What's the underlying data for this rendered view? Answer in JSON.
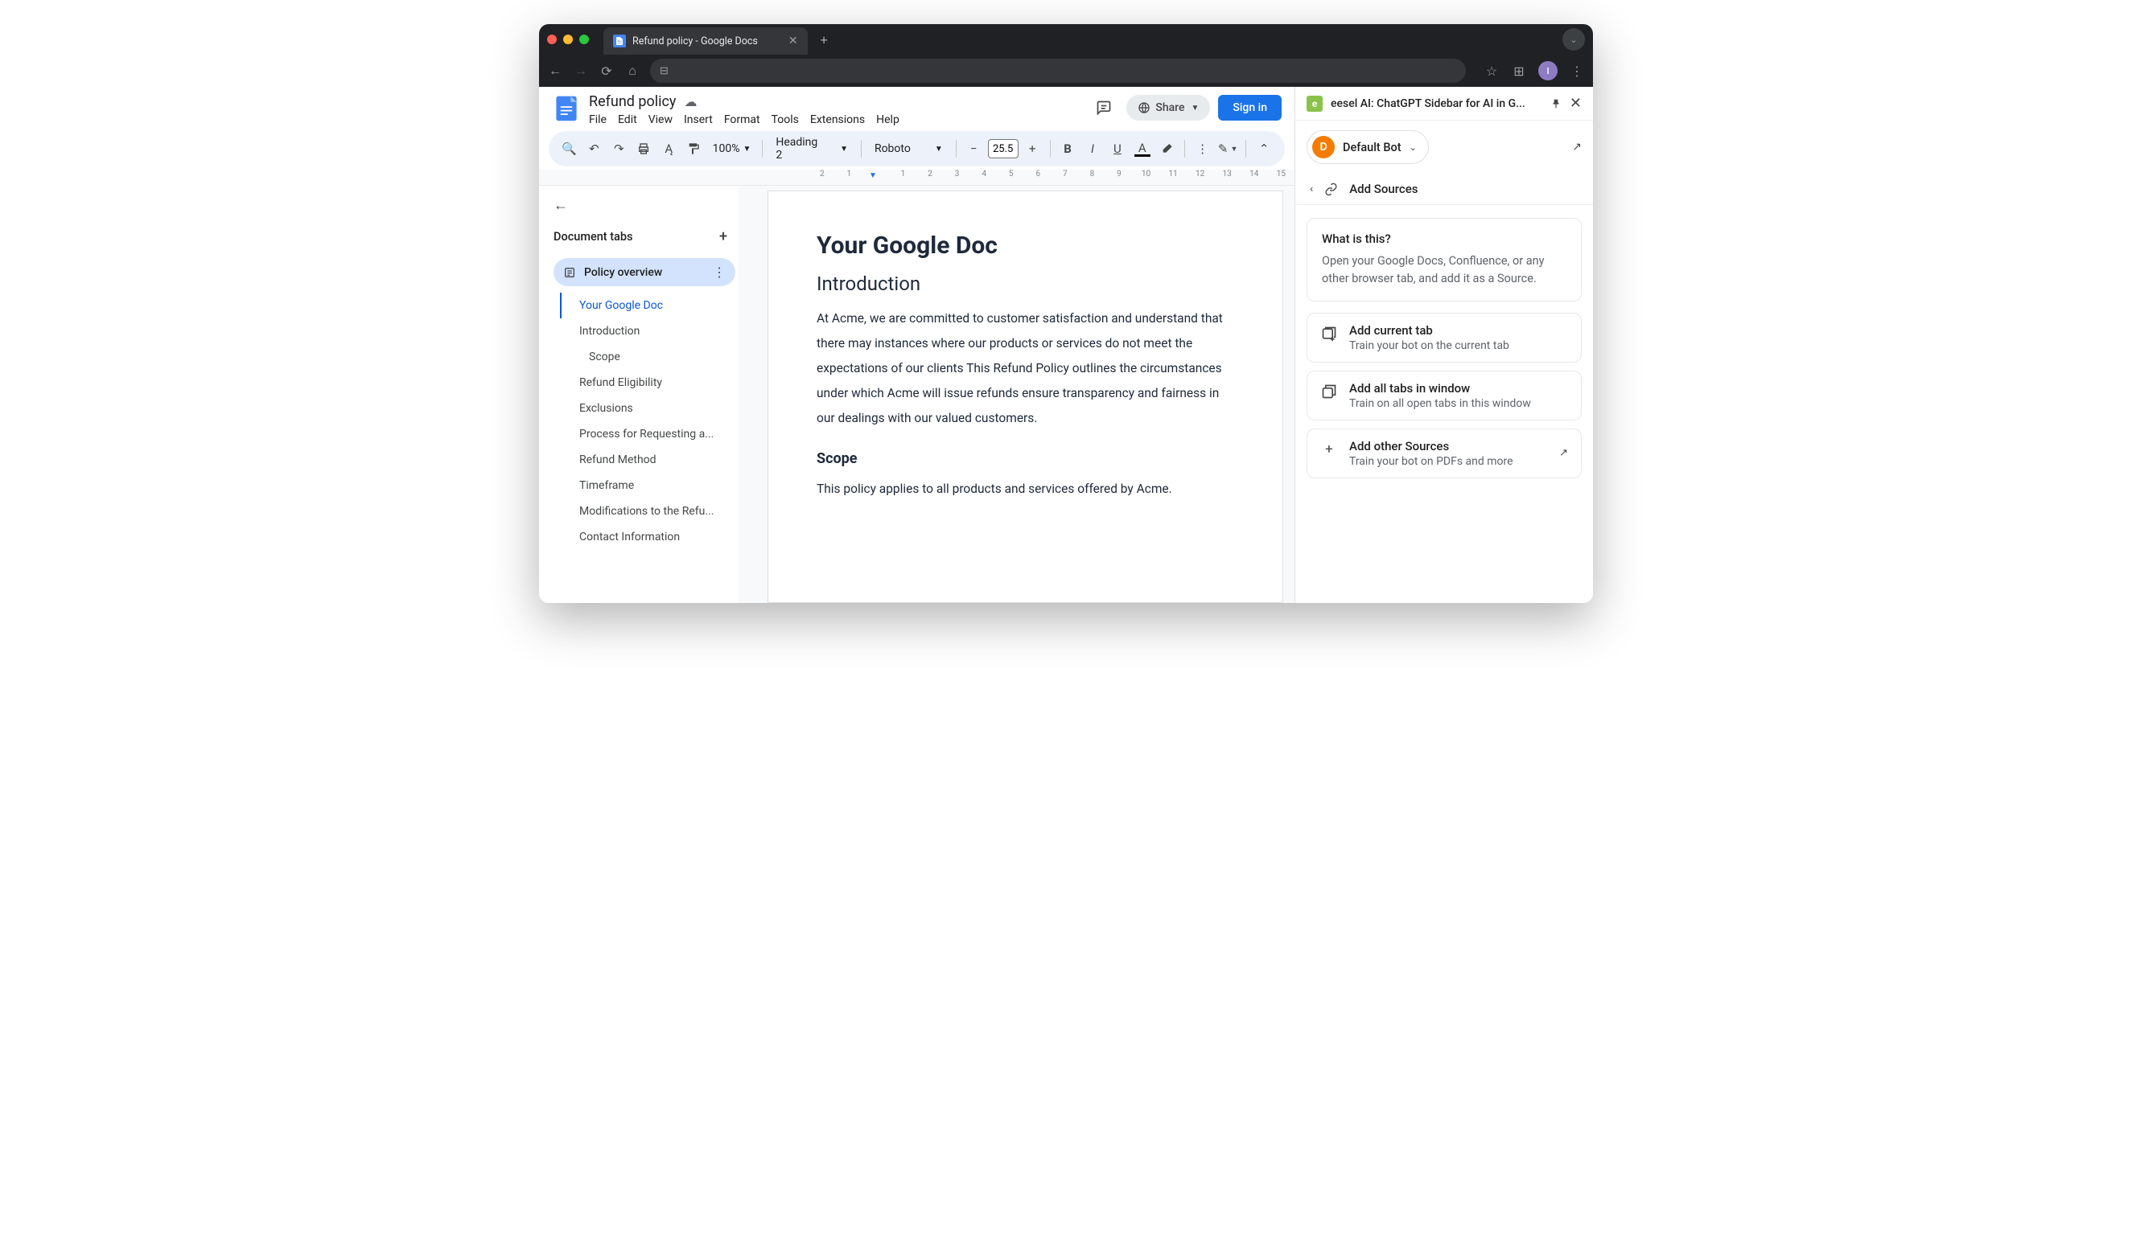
{
  "browser": {
    "tab_title": "Refund policy - Google Docs",
    "avatar_letter": "I"
  },
  "docs": {
    "title": "Refund policy",
    "menu": [
      "File",
      "Edit",
      "View",
      "Insert",
      "Format",
      "Tools",
      "Extensions",
      "Help"
    ],
    "share_label": "Share",
    "signin_label": "Sign in",
    "zoom": "100%",
    "style_select": "Heading 2",
    "font_select": "Roboto",
    "font_size": "25.5",
    "ruler_nums": [
      "2",
      "1",
      "",
      "1",
      "2",
      "3",
      "4",
      "5",
      "6",
      "7",
      "8",
      "9",
      "10",
      "11",
      "12",
      "13",
      "14",
      "15"
    ]
  },
  "outline": {
    "header": "Document tabs",
    "active_tab": "Policy overview",
    "items": [
      {
        "label": "Your Google Doc",
        "active": true,
        "indent": 1
      },
      {
        "label": "Introduction",
        "active": false,
        "indent": 1
      },
      {
        "label": "Scope",
        "active": false,
        "indent": 2
      },
      {
        "label": "Refund Eligibility",
        "active": false,
        "indent": 1
      },
      {
        "label": "Exclusions",
        "active": false,
        "indent": 1
      },
      {
        "label": "Process for Requesting a...",
        "active": false,
        "indent": 1
      },
      {
        "label": "Refund Method",
        "active": false,
        "indent": 1
      },
      {
        "label": "Timeframe",
        "active": false,
        "indent": 1
      },
      {
        "label": "Modifications to the Refu...",
        "active": false,
        "indent": 1
      },
      {
        "label": "Contact Information",
        "active": false,
        "indent": 1
      }
    ]
  },
  "document": {
    "h1": "Your Google Doc",
    "h2_intro": "Introduction",
    "p_intro": "At Acme, we are committed to customer satisfaction and understand that there may instances where our products or services do not meet the expectations of our clients This Refund Policy outlines the circumstances under which Acme will issue refunds ensure transparency and fairness in our dealings with our valued customers.",
    "h3_scope": "Scope",
    "p_scope": "This policy applies to all products and services offered by Acme."
  },
  "extension": {
    "title": "eesel AI: ChatGPT Sidebar for AI in G...",
    "bot_letter": "D",
    "bot_name": "Default Bot",
    "nav_title": "Add Sources",
    "info_title": "What is this?",
    "info_body": "Open your Google Docs, Confluence, or any other browser tab, and add it as a Source.",
    "actions": [
      {
        "title": "Add current tab",
        "sub": "Train your bot on the current tab",
        "icon": "tab-add",
        "arrow": false
      },
      {
        "title": "Add all tabs in window",
        "sub": "Train on all open tabs in this window",
        "icon": "tabs",
        "arrow": false
      },
      {
        "title": "Add other Sources",
        "sub": "Train your bot on PDFs and more",
        "icon": "plus",
        "arrow": true
      }
    ]
  }
}
